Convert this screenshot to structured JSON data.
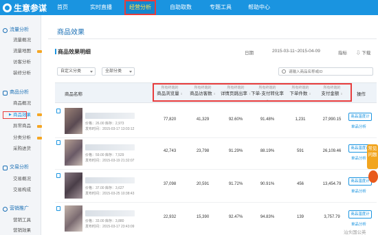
{
  "brand": {
    "name": "生意参谋"
  },
  "nav": [
    {
      "label": "首页"
    },
    {
      "label": "实时直播"
    },
    {
      "label": "经营分析",
      "active": true
    },
    {
      "label": "自助取数"
    },
    {
      "label": "专题工具"
    },
    {
      "label": "帮助中心"
    }
  ],
  "sidebar": {
    "traffic": {
      "title": "流量分析",
      "items": [
        "流量概况",
        "流量地图",
        "访客分析",
        "装修分析"
      ]
    },
    "product": {
      "title": "商品分析",
      "items": [
        "商品概况",
        "商品效果",
        "异常商品",
        "分类分析",
        "采购进货"
      ]
    },
    "trade": {
      "title": "交易分析",
      "items": [
        "交易概况",
        "交易构成"
      ]
    },
    "marketing": {
      "title": "营销推广",
      "items": [
        "营销工具",
        "营销效果"
      ]
    }
  },
  "main": {
    "page_title": "商品效果",
    "card_title": "商品效果明细",
    "date_label": "日期",
    "date_range": "2015-03-11~2015-04-09",
    "metric_label": "指标",
    "download": "下载",
    "filter_custom": "自定义分类",
    "filter_all": "全部分类",
    "search_placeholder": "请输入商品名称或ID"
  },
  "table": {
    "name_header": "商品名称",
    "op_header": "操作",
    "subheader": "所有终端的",
    "columns": [
      "商品浏览量",
      "商品访客数",
      "详情页跳出率",
      "下单-支付转化率",
      "下单件数",
      "支付金额"
    ],
    "rows": [
      {
        "price": "价格：26.00",
        "stock": "库存：2,973",
        "published": "发布时间：2015-03-17 13:03:12",
        "values": [
          "77,820",
          "41,329",
          "92.60%",
          "91.48%",
          "1,231",
          "27,990.15"
        ]
      },
      {
        "price": "价格：59.00",
        "stock": "库存：7,529",
        "published": "发布时间：2015-03-19 21:32:07",
        "values": [
          "42,743",
          "23,798",
          "91.29%",
          "88.19%",
          "591",
          "26,109.46"
        ]
      },
      {
        "price": "价格：37.00",
        "stock": "库存：3,627",
        "published": "发布时间：2015-03-25 10:38:43",
        "values": [
          "37,098",
          "20,591",
          "91.72%",
          "90.91%",
          "456",
          "13,454.79"
        ]
      },
      {
        "price": "价格：33.00",
        "stock": "库存：3,880",
        "published": "发布时间：2015-03-17 23:43:09",
        "values": [
          "22,932",
          "15,390",
          "92.47%",
          "94.83%",
          "139",
          "3,757.79"
        ]
      }
    ],
    "btn_trend": "商品温度计",
    "btn_single": "单品分析"
  },
  "float_help": "常见问题",
  "watermark": "汕头国公英"
}
